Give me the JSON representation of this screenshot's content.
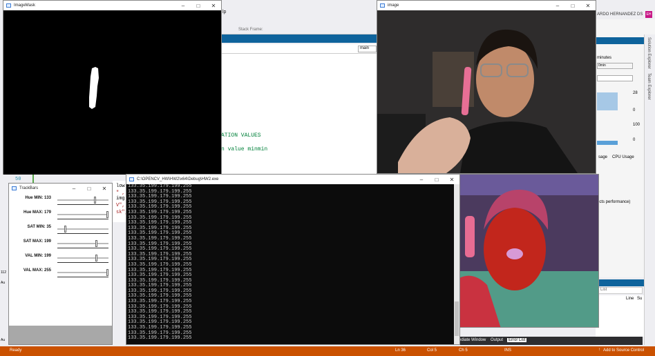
{
  "vs": {
    "menu_fragment": "lp",
    "stack_frame": "Stack Frame:",
    "nav_value": "main",
    "code_lines": [
      "ATION VALUES",
      "n value minmin"
    ],
    "user": "ARDO HERNANDEZ DS",
    "user_initials": "EH",
    "right_panel": {
      "label": "minutes",
      "value": "0min",
      "v1": "28",
      "v2": "0",
      "v3": "100",
      "v4": "0",
      "tab1": "sage",
      "tab2": "CPU Usage",
      "perf_note": "ects performance)"
    },
    "right_sidebar": [
      "Solution Explorer",
      "Team Explorer"
    ],
    "bottom_panel": {
      "list_label": "List",
      "col_line": "Line",
      "col_su": "Su"
    },
    "bottom_tabs": [
      "ediate Window",
      "Output",
      "Error List"
    ],
    "left_code_fragments": [
      "low",
      "\" ,",
      "img",
      "V\",",
      "sk\","
    ],
    "gutter_number": "50",
    "status": {
      "ready": "Ready",
      "ln": "Ln 36",
      "col": "Col 5",
      "ch": "Ch 5",
      "ins": "INS",
      "source_control": "Add to Source Control"
    },
    "left_marks": [
      "112",
      "Au",
      "Au"
    ]
  },
  "mask_window": {
    "title": "ImageMask"
  },
  "image_window": {
    "title": "image"
  },
  "trackbars_window": {
    "title": "TrackBars",
    "bars": [
      {
        "label": "Hue MIN: 133",
        "value": 133,
        "max": 179
      },
      {
        "label": "Hue MAX: 179",
        "value": 179,
        "max": 179
      },
      {
        "label": "SAT MIN: 35",
        "value": 35,
        "max": 255
      },
      {
        "label": "SAT MAX: 199",
        "value": 199,
        "max": 255
      },
      {
        "label": "VAL MIN: 199",
        "value": 199,
        "max": 255
      },
      {
        "label": "VAL MAX: 255",
        "value": 255,
        "max": 255
      }
    ]
  },
  "console_window": {
    "title": "C:\\OPENCV_HW\\HW2\\x64\\Debug\\HW2.exe",
    "line": "133.35.199.179.199.255",
    "line_count": 30
  },
  "colors": {
    "vs_blue": "#0e639c",
    "status_orange": "#ca5100",
    "console_bg": "#0c0c0c"
  }
}
